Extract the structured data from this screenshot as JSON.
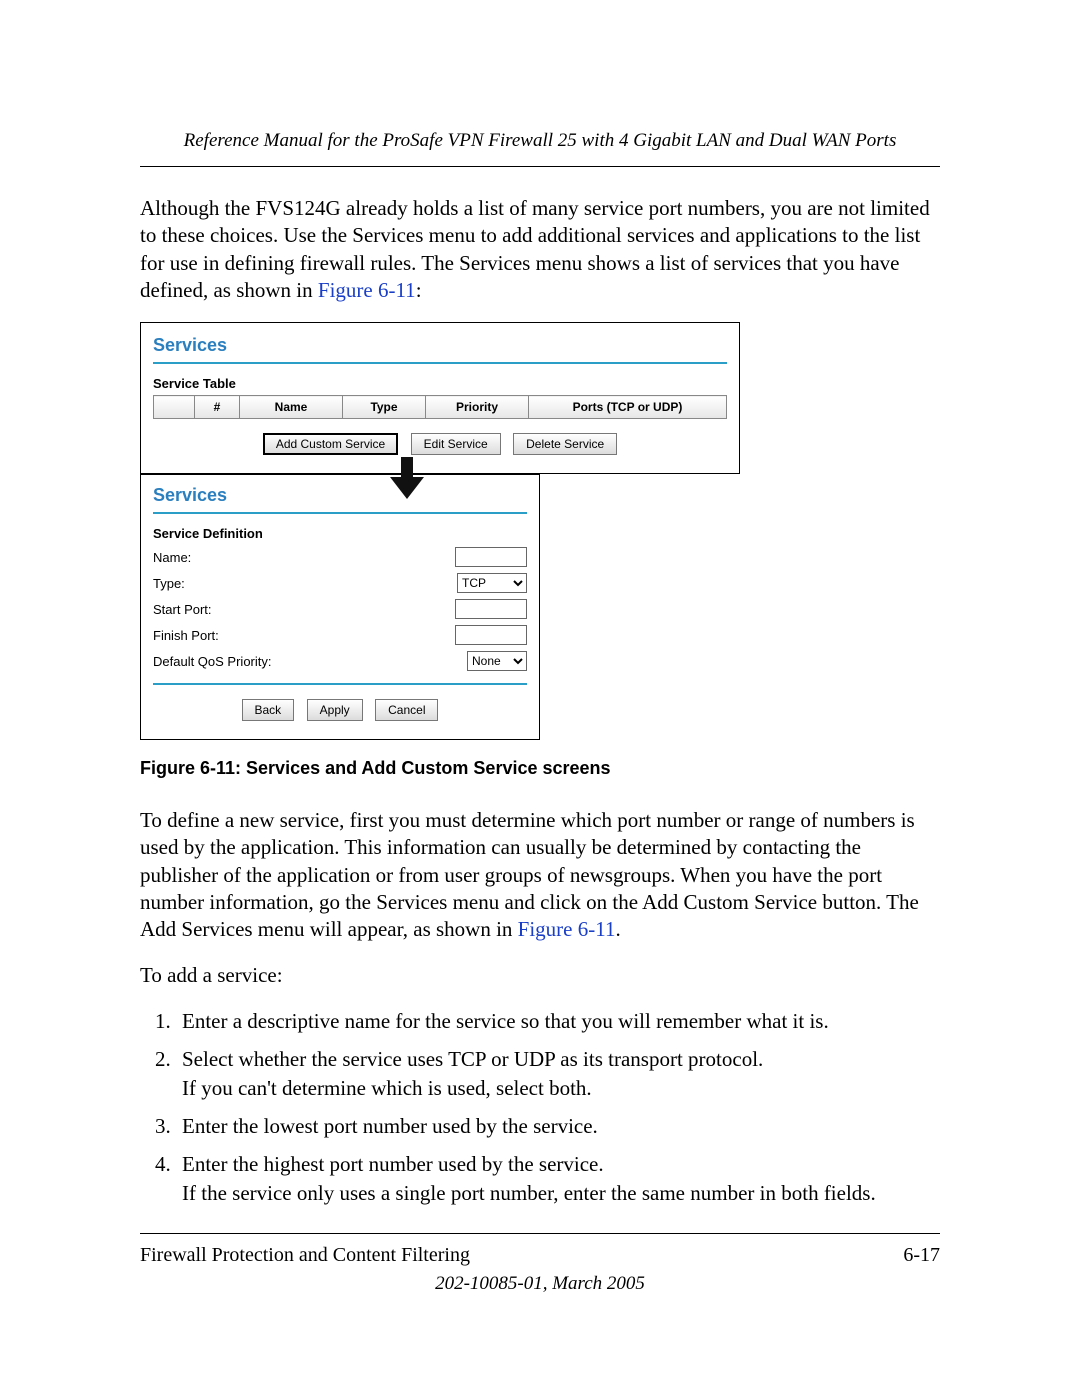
{
  "header": {
    "running_title": "Reference Manual for the ProSafe VPN Firewall 25 with 4 Gigabit LAN and Dual WAN Ports"
  },
  "intro": {
    "para": "Although the FVS124G already holds a list of many service port numbers, you are not limited to these choices. Use the Services menu to add additional services and applications to the list for use in defining firewall rules. The Services menu shows a list of services that you have defined, as shown in ",
    "figref": "Figure 6-11",
    "tail": ":"
  },
  "screens": {
    "top": {
      "title": "Services",
      "subhead": "Service Table",
      "cols": {
        "sel": "",
        "num": "#",
        "name": "Name",
        "type": "Type",
        "priority": "Priority",
        "ports": "Ports (TCP or UDP)"
      },
      "buttons": {
        "add": "Add Custom Service",
        "edit": "Edit Service",
        "del": "Delete Service"
      }
    },
    "bottom": {
      "title": "Services",
      "subhead": "Service Definition",
      "fields": {
        "name_label": "Name:",
        "type_label": "Type:",
        "type_value": "TCP",
        "start_label": "Start Port:",
        "finish_label": "Finish Port:",
        "qos_label": "Default QoS Priority:",
        "qos_value": "None"
      },
      "buttons": {
        "back": "Back",
        "apply": "Apply",
        "cancel": "Cancel"
      }
    }
  },
  "caption": "Figure 6-11:  Services and Add Custom Service screens",
  "after": {
    "para_pre": "To define a new service, first you must determine which port number or range of numbers is used by the application. This information can usually be determined by contacting the publisher of the application or from user groups of newsgroups. When you have the port number information, go the Services menu and click on the Add Custom Service button. The Add Services menu will appear, as shown in ",
    "figref": "Figure 6-11",
    "para_post": ".",
    "lead": "To add a service:",
    "steps": [
      "Enter a descriptive name for the service so that you will remember what it is.",
      "Select whether the service uses TCP or UDP as its transport protocol.\nIf you can't determine which is used, select both.",
      "Enter the lowest port number used by the service.",
      "Enter the highest port number used by the service.\nIf the service only uses a single port number, enter the same number in both fields."
    ]
  },
  "footer": {
    "section": "Firewall Protection and Content Filtering",
    "page": "6-17",
    "docid": "202-10085-01, March 2005"
  }
}
